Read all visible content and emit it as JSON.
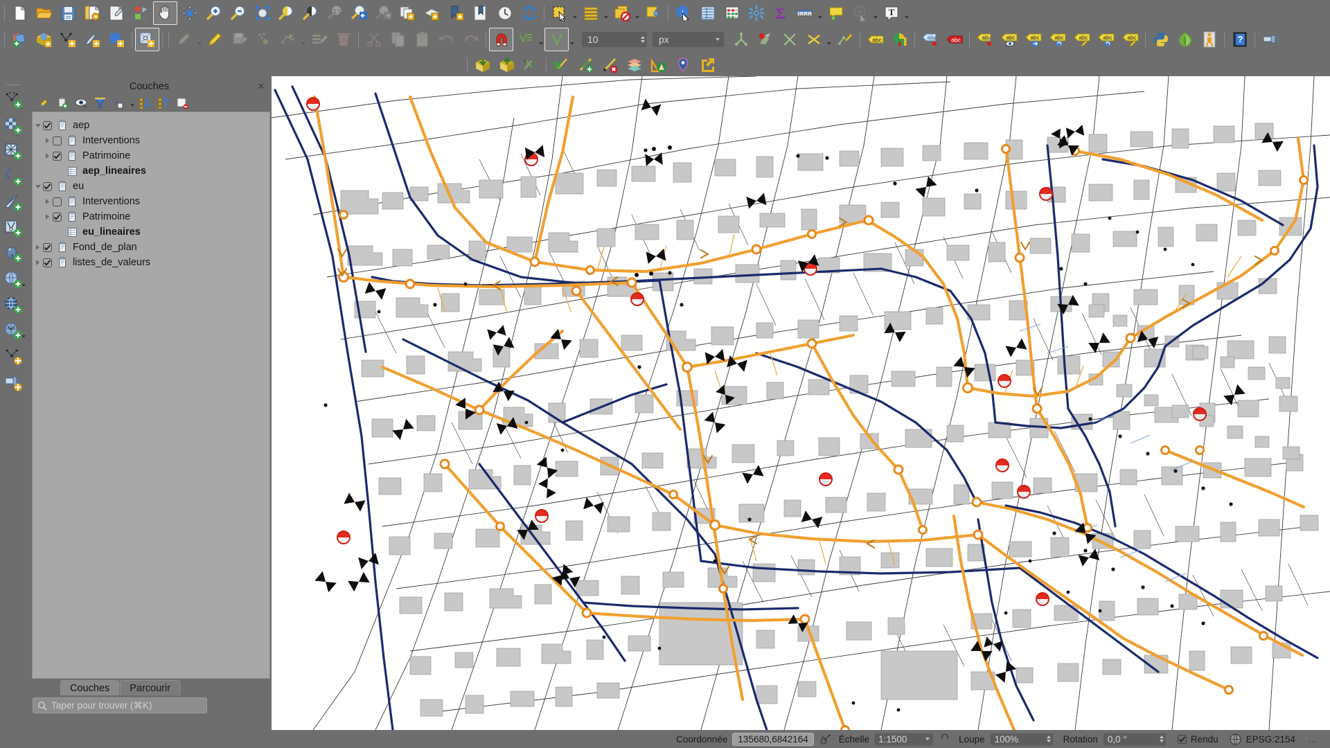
{
  "app": {
    "title": "QGIS"
  },
  "toolbars": {
    "row1": [
      {
        "name": "new-project-icon",
        "label": "Nouveau projet",
        "type": "icon"
      },
      {
        "name": "open-project-icon",
        "label": "Ouvrir un projet",
        "type": "icon"
      },
      {
        "name": "save-project-icon",
        "label": "Enregistrer le projet",
        "type": "icon"
      },
      {
        "name": "save-project-as-icon",
        "label": "Enregistrer le projet sous",
        "type": "icon"
      },
      {
        "name": "new-print-layout-icon",
        "label": "Nouvelle mise en page",
        "type": "icon"
      },
      {
        "name": "style-manager-icon",
        "label": "Gestionnaire de styles",
        "type": "icon"
      },
      {
        "name": "pan-map-icon",
        "label": "Déplacer la carte",
        "type": "icon",
        "active": true
      },
      {
        "name": "pan-to-selection-icon",
        "label": "Déplacer la carte vers la sélection",
        "type": "icon"
      },
      {
        "name": "zoom-in-icon",
        "label": "Zoom avant",
        "type": "icon"
      },
      {
        "name": "zoom-out-icon",
        "label": "Zoom arrière",
        "type": "icon"
      },
      {
        "name": "zoom-full-icon",
        "label": "Zoom complet",
        "type": "icon"
      },
      {
        "name": "zoom-to-selection-icon",
        "label": "Zoom sur la sélection",
        "type": "icon"
      },
      {
        "name": "zoom-to-layer-icon",
        "label": "Zoom sur la couche",
        "type": "icon"
      },
      {
        "name": "zoom-native-icon",
        "label": "Zoom à la résolution native",
        "type": "icon"
      },
      {
        "name": "zoom-last-icon",
        "label": "Zoom précédent",
        "type": "icon"
      },
      {
        "name": "zoom-next-icon",
        "label": "Zoom suivant",
        "type": "icon"
      },
      {
        "name": "new-map-view-icon",
        "label": "Nouvelle vue carte",
        "type": "icon"
      },
      {
        "name": "new-3d-map-view-icon",
        "label": "Nouvelle vue 3D",
        "type": "icon"
      },
      {
        "name": "show-bookmarks-icon",
        "label": "Afficher les signets",
        "type": "icon"
      },
      {
        "name": "new-bookmark-icon",
        "label": "Nouveau signet",
        "type": "icon"
      },
      {
        "name": "temporal-controller-icon",
        "label": "Contrôleur temporel",
        "type": "icon"
      },
      {
        "name": "refresh-icon",
        "label": "Rafraîchir",
        "type": "icon"
      },
      {
        "name": "select-features-icon",
        "label": "Sélectionner des entités",
        "type": "icon",
        "dropdown": true
      },
      {
        "name": "select-by-expression-icon",
        "label": "Sélectionner par expression",
        "type": "icon",
        "dropdown": true
      },
      {
        "name": "deselect-all-icon",
        "label": "Tout désélectionner",
        "type": "icon",
        "dropdown": true
      },
      {
        "name": "select-value-icon",
        "label": "Sélectionner par valeur",
        "type": "icon"
      },
      {
        "name": "identify-features-icon",
        "label": "Identifier les entités",
        "type": "icon"
      },
      {
        "name": "open-attribute-table-icon",
        "label": "Ouvrir la table d'attributs",
        "type": "icon"
      },
      {
        "name": "field-calculator-icon",
        "label": "Calculatrice de champ",
        "type": "icon"
      },
      {
        "name": "processing-toolbox-icon",
        "label": "Boîte à outils de traitement",
        "type": "icon"
      },
      {
        "name": "statistical-summary-icon",
        "label": "Résumé statistique",
        "type": "icon"
      },
      {
        "name": "measure-line-icon",
        "label": "Mesurer une ligne",
        "type": "icon",
        "dropdown": true
      },
      {
        "name": "map-tips-icon",
        "label": "Infobulles de carte",
        "type": "icon"
      },
      {
        "name": "run-feature-action-icon",
        "label": "Exécuter l'action",
        "type": "icon",
        "dropdown": true
      },
      {
        "name": "text-annotation-icon",
        "label": "Annotation texte",
        "type": "icon",
        "dropdown": true
      }
    ],
    "row2": [
      {
        "name": "add-vector-layer-icon",
        "label": "Ajouter une couche vecteur"
      },
      {
        "name": "add-raster-layer-icon",
        "label": "Ajouter une couche raster"
      },
      {
        "name": "add-delimited-text-layer-icon",
        "label": "Ajouter une couche de texte délimité"
      },
      {
        "name": "add-spatialite-layer-icon",
        "label": "Ajouter une couche SpatiaLite"
      },
      {
        "name": "add-mesh-layer-icon",
        "label": "Ajouter une couche de maillage"
      },
      {
        "name": "add-vector-tile-layer-icon",
        "label": "Ajouter une couche de tuiles vectorielles"
      },
      {
        "name": "current-edits-icon",
        "label": "Édition en cours",
        "dropdown": true,
        "disabled": true
      },
      {
        "name": "toggle-editing-icon",
        "label": "Basculer en mode édition"
      },
      {
        "name": "save-layer-edits-icon",
        "label": "Enregistrer les modifications",
        "disabled": true
      },
      {
        "name": "add-point-feature-icon",
        "label": "Ajouter une entité ponctuelle",
        "disabled": true
      },
      {
        "name": "vertex-tool-icon",
        "label": "Outil de nœuds",
        "dropdown": true,
        "disabled": true
      },
      {
        "name": "modify-attributes-icon",
        "label": "Modifier les attributs",
        "disabled": true
      },
      {
        "name": "delete-selected-icon",
        "label": "Supprimer la sélection",
        "disabled": true
      },
      {
        "name": "cut-features-icon",
        "label": "Couper les entités",
        "disabled": true
      },
      {
        "name": "copy-features-icon",
        "label": "Copier les entités",
        "disabled": true
      },
      {
        "name": "paste-features-icon",
        "label": "Coller les entités",
        "disabled": true
      },
      {
        "name": "undo-icon",
        "label": "Annuler",
        "disabled": true
      },
      {
        "name": "redo-icon",
        "label": "Rétablir",
        "disabled": true
      },
      {
        "name": "snapping-magnet-icon",
        "label": "Activer l'accrochage",
        "active": true
      },
      {
        "name": "snapping-mode-icon",
        "label": "Mode d'accrochage",
        "dropdown": true
      },
      {
        "name": "snapping-type-icon",
        "label": "Type d'accrochage",
        "dropdown": true,
        "active": true
      },
      {
        "name": "snapping-tolerance-field",
        "label": "Tolérance"
      },
      {
        "name": "snapping-units-combo",
        "label": "Unités"
      },
      {
        "name": "topological-editing-icon",
        "label": "Édition topologique"
      },
      {
        "name": "avoid-overlap-icon",
        "label": "Éviter les chevauchements"
      },
      {
        "name": "snap-intersection-icon",
        "label": "Accrochage aux intersections"
      },
      {
        "name": "self-snapping-icon",
        "label": "Auto-accrochage",
        "dropdown": true
      },
      {
        "name": "trace-icon",
        "label": "Tracer"
      },
      {
        "name": "label-toolbar-icon",
        "label": "Étiquettes"
      },
      {
        "name": "layer-diagram-icon",
        "label": "Diagrammes de couche"
      },
      {
        "name": "pin-labels-icon",
        "label": "Épingler les étiquettes"
      },
      {
        "name": "highlight-labels-icon",
        "label": "Surligner les étiquettes"
      },
      {
        "name": "move-label-icon",
        "label": "Déplacer une étiquette"
      },
      {
        "name": "show-hide-labels-icon",
        "label": "Afficher/Masquer les étiquettes"
      },
      {
        "name": "move-label-diagram-icon",
        "label": "Déplacer étiquette/diagramme"
      },
      {
        "name": "rotate-label-icon",
        "label": "Rotation d'étiquette"
      },
      {
        "name": "change-label-icon",
        "label": "Modifier l'étiquette"
      },
      {
        "name": "rotate-label-2-icon",
        "label": "Rotation d'étiquette"
      },
      {
        "name": "edit-label-icon",
        "label": "Éditer l'étiquette"
      },
      {
        "name": "python-console-icon",
        "label": "Console Python"
      },
      {
        "name": "plugin-manager-icon",
        "label": "Gestionnaire d'extensions"
      },
      {
        "name": "georeferencer-icon",
        "label": "Géoréférenceur"
      },
      {
        "name": "help-icon",
        "label": "Aide"
      },
      {
        "name": "messages-icon",
        "label": "Messages"
      }
    ],
    "row3": [
      {
        "name": "add-to-qconsolidate-icon",
        "label": "Empaqueter"
      },
      {
        "name": "extract-package-icon",
        "label": "Extraire le paquet"
      },
      {
        "name": "qfield-sync-icon",
        "label": "Synchronisation QField"
      },
      {
        "name": "network-analysis-icon",
        "label": "Analyse de réseau"
      },
      {
        "name": "add-network-link-icon",
        "label": "Ajouter un tronçon"
      },
      {
        "name": "delete-network-link-icon",
        "label": "Supprimer un tronçon"
      },
      {
        "name": "layer-stack-icon",
        "label": "Empilement de couches"
      },
      {
        "name": "profile-tool-icon",
        "label": "Outil profil"
      },
      {
        "name": "place-marker-icon",
        "label": "Placer un repère"
      },
      {
        "name": "export-icon",
        "label": "Exporter"
      }
    ]
  },
  "left_toolbar": [
    {
      "name": "add-vector-layer-icon",
      "label": "Ajouter une couche vecteur"
    },
    {
      "name": "add-raster-layer-icon",
      "label": "Ajouter une couche raster"
    },
    {
      "name": "add-mesh-layer-icon",
      "label": "Ajouter une couche maillage"
    },
    {
      "name": "add-delimited-text-layer-icon",
      "label": "Ajouter une couche texte délimité"
    },
    {
      "name": "add-spatialite-layer-icon",
      "label": "Ajouter une couche SpatiaLite"
    },
    {
      "name": "add-virtual-layer-icon",
      "label": "Ajouter une couche virtuelle"
    },
    {
      "name": "add-postgis-layer-icon",
      "label": "Ajouter une couche PostGIS"
    },
    {
      "name": "add-wms-layer-icon",
      "label": "Ajouter une couche WMS/WMTS",
      "dropdown": true
    },
    {
      "name": "add-wfs-layer-icon",
      "label": "Ajouter une couche WFS"
    },
    {
      "name": "add-wcs-layer-icon",
      "label": "Ajouter une couche WCS",
      "dropdown": true
    },
    {
      "name": "add-arcgis-layer-icon",
      "label": "Ajouter une couche ArcGIS REST"
    },
    {
      "name": "add-point-cloud-layer-icon",
      "label": "Ajouter une couche de nuage de points"
    }
  ],
  "layers_panel": {
    "title": "Couches",
    "close_label": "✕",
    "toolbar": [
      {
        "name": "open-layer-styling-icon",
        "label": "Ouvrir le panneau de style"
      },
      {
        "name": "add-group-icon",
        "label": "Ajouter un groupe"
      },
      {
        "name": "manage-layer-visibility-icon",
        "label": "Gérer la visibilité des couches"
      },
      {
        "name": "filter-legend-icon",
        "label": "Filtrer la légende"
      },
      {
        "name": "filter-legend-expression-icon",
        "label": "Filtrer la légende par expression",
        "dropdown": true
      },
      {
        "name": "expand-all-icon",
        "label": "Tout développer"
      },
      {
        "name": "collapse-all-icon",
        "label": "Tout réduire"
      },
      {
        "name": "remove-layer-icon",
        "label": "Supprimer la couche/le groupe"
      }
    ],
    "tree": [
      {
        "label": "aep",
        "level": 0,
        "expander": "down",
        "checked": true,
        "icon": "group-icon",
        "bold": false
      },
      {
        "label": "Interventions",
        "level": 1,
        "expander": "right",
        "checked": false,
        "icon": "group-icon",
        "bold": false
      },
      {
        "label": "Patrimoine",
        "level": 1,
        "expander": "right",
        "checked": true,
        "icon": "group-icon",
        "bold": false
      },
      {
        "label": "aep_lineaires",
        "level": 1,
        "expander": "none",
        "checked": null,
        "icon": "table-icon",
        "bold": true
      },
      {
        "label": "eu",
        "level": 0,
        "expander": "down",
        "checked": true,
        "icon": "group-icon",
        "bold": false
      },
      {
        "label": "Interventions",
        "level": 1,
        "expander": "right",
        "checked": false,
        "icon": "group-icon",
        "bold": false
      },
      {
        "label": "Patrimoine",
        "level": 1,
        "expander": "right",
        "checked": true,
        "icon": "group-icon",
        "bold": false
      },
      {
        "label": "eu_lineaires",
        "level": 1,
        "expander": "none",
        "checked": null,
        "icon": "table-icon",
        "bold": true
      },
      {
        "label": "Fond_de_plan",
        "level": 0,
        "expander": "right",
        "checked": true,
        "icon": "group-icon",
        "bold": false
      },
      {
        "label": "listes_de_valeurs",
        "level": 0,
        "expander": "right",
        "checked": true,
        "icon": "group-icon",
        "bold": false
      }
    ],
    "tabs": [
      {
        "label": "Couches",
        "selected": true,
        "name": "tab-couches"
      },
      {
        "label": "Parcourir",
        "selected": false,
        "name": "tab-parcourir"
      }
    ]
  },
  "locator": {
    "placeholder": "Taper pour trouver (⌘K)"
  },
  "snapping": {
    "tolerance": "10",
    "units": "px"
  },
  "status_bar": {
    "coordinate_label": "Coordonnée",
    "coordinate_value": "135680,6842164",
    "scale_label": "Échelle",
    "scale_value": "1:1500",
    "magnifier_label": "Loupe",
    "magnifier_value": "100%",
    "rotation_label": "Rotation",
    "rotation_value": "0,0 °",
    "render_label": "Rendu",
    "render_checked": true,
    "crs_label": "EPSG:2154",
    "messages_label": "…"
  },
  "map": {
    "background": "#ffffff",
    "colors": {
      "parcel_line": "#3c3c3c",
      "building_fill": "#c8c8c8",
      "building_stroke": "#9a9a9a",
      "aep_network": "#f0a030",
      "eu_network": "#1b2a6b",
      "node_orange": "#e8891c",
      "hydrant_red": "#e52b1e",
      "valve_black": "#101010",
      "branch_thin": "#6f9fd8"
    }
  }
}
